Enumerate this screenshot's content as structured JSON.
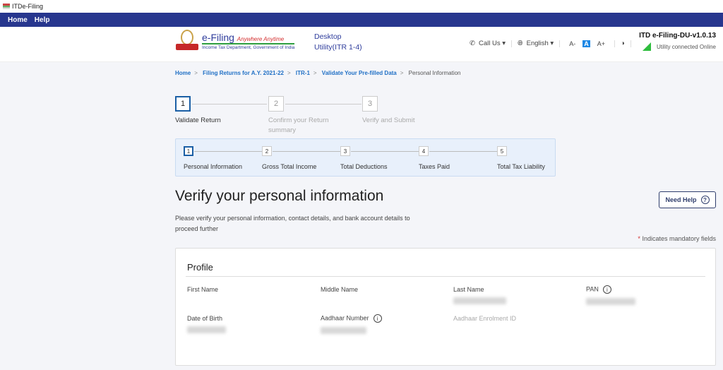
{
  "window": {
    "title": "ITDe-Filing"
  },
  "menu": {
    "items": [
      "Home",
      "Help"
    ]
  },
  "header": {
    "brand": "e-Filing",
    "tagline": "Anywhere Anytime",
    "dept": "Income Tax Department, Government of India",
    "utility_line1": "Desktop",
    "utility_line2": "Utility(ITR 1-4)",
    "call_us": "Call Us",
    "language": "English",
    "font_small": "A-",
    "font_normal": "A",
    "font_large": "A+",
    "version": "ITD e-Filing-DU-v1.0.13",
    "status": "Utility connected Online",
    "status_color": "#2ebd3e"
  },
  "breadcrumb": {
    "items": [
      "Home",
      "Filing Returns for A.Y. 2021-22",
      "ITR-1",
      "Validate Your Pre-filled Data"
    ],
    "current": "Personal Information"
  },
  "stepper": {
    "steps": [
      {
        "num": "1",
        "label": "Validate Return",
        "active": true
      },
      {
        "num": "2",
        "label": "Confirm your Return summary",
        "active": false
      },
      {
        "num": "3",
        "label": "Verify and Submit",
        "active": false
      }
    ]
  },
  "substepper": {
    "steps": [
      {
        "num": "1",
        "label": "Personal Information",
        "active": true
      },
      {
        "num": "2",
        "label": "Gross Total Income",
        "active": false
      },
      {
        "num": "3",
        "label": "Total Deductions",
        "active": false
      },
      {
        "num": "4",
        "label": "Taxes Paid",
        "active": false
      },
      {
        "num": "5",
        "label": "Total Tax Liability",
        "active": false
      }
    ]
  },
  "page": {
    "title": "Verify your personal information",
    "description": "Please verify your personal information, contact details, and bank account details to proceed further",
    "need_help": "Need Help",
    "mandatory_star": "*",
    "mandatory_text": " Indicates mandatory fields"
  },
  "profile": {
    "title": "Profile",
    "first_name": "First Name",
    "middle_name": "Middle Name",
    "last_name": "Last Name",
    "pan": "PAN",
    "dob": "Date of Birth",
    "aadhaar": "Aadhaar Number",
    "enrolment": "Aadhaar Enrolment ID"
  }
}
